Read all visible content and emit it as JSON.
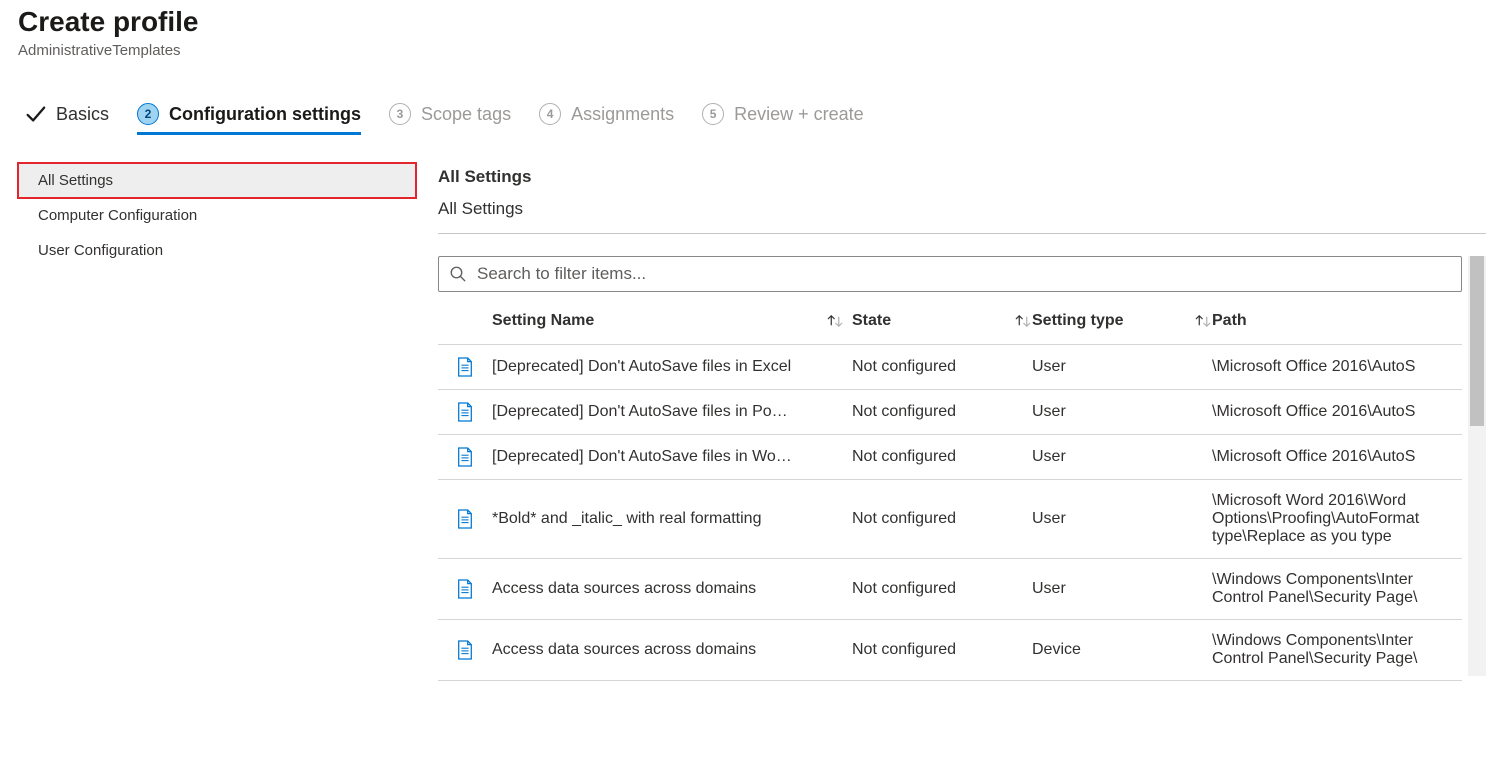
{
  "header": {
    "title": "Create profile",
    "subtitle": "AdministrativeTemplates"
  },
  "wizard": {
    "steps": [
      {
        "num": "",
        "label": "Basics",
        "state": "completed"
      },
      {
        "num": "2",
        "label": "Configuration settings",
        "state": "active"
      },
      {
        "num": "3",
        "label": "Scope tags",
        "state": "pending"
      },
      {
        "num": "4",
        "label": "Assignments",
        "state": "pending"
      },
      {
        "num": "5",
        "label": "Review + create",
        "state": "pending"
      }
    ]
  },
  "tree": {
    "items": [
      {
        "label": "All Settings",
        "selected": true
      },
      {
        "label": "Computer Configuration",
        "selected": false
      },
      {
        "label": "User Configuration",
        "selected": false
      }
    ]
  },
  "content": {
    "heading": "All Settings",
    "breadcrumb": "All Settings",
    "search_placeholder": "Search to filter items...",
    "columns": {
      "name": "Setting Name",
      "state": "State",
      "type": "Setting type",
      "path": "Path"
    },
    "rows": [
      {
        "name": "[Deprecated] Don't AutoSave files in Excel",
        "state": "Not configured",
        "type": "User",
        "path": "\\Microsoft Office 2016\\AutoS"
      },
      {
        "name": "[Deprecated] Don't AutoSave files in Po…",
        "state": "Not configured",
        "type": "User",
        "path": "\\Microsoft Office 2016\\AutoS"
      },
      {
        "name": "[Deprecated] Don't AutoSave files in Wo…",
        "state": "Not configured",
        "type": "User",
        "path": "\\Microsoft Office 2016\\AutoS"
      },
      {
        "name": "*Bold* and _italic_ with real formatting",
        "state": "Not configured",
        "type": "User",
        "path": "\\Microsoft Word 2016\\Word Options\\Proofing\\AutoFormat type\\Replace as you type"
      },
      {
        "name": "Access data sources across domains",
        "state": "Not configured",
        "type": "User",
        "path": "\\Windows Components\\Inter Control Panel\\Security Page\\"
      },
      {
        "name": "Access data sources across domains",
        "state": "Not configured",
        "type": "Device",
        "path": "\\Windows Components\\Inter Control Panel\\Security Page\\"
      }
    ]
  }
}
